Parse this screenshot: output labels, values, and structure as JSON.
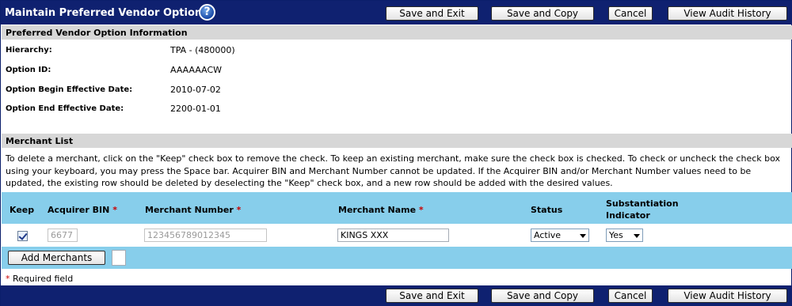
{
  "header": {
    "title": "Maintain Preferred Vendor Option",
    "help_icon": "?"
  },
  "actions": {
    "save_exit": "Save and Exit",
    "save_copy": "Save and Copy",
    "cancel": "Cancel",
    "audit": "View Audit History"
  },
  "info": {
    "section_title": "Preferred Vendor Option Information",
    "fields": [
      {
        "label": "Hierarchy:",
        "value": "TPA - (480000)"
      },
      {
        "label": "Option ID:",
        "value": "AAAAAACW"
      },
      {
        "label": "Option Begin Effective Date:",
        "value": "2010-07-02"
      },
      {
        "label": "Option End Effective Date:",
        "value": "2200-01-01"
      }
    ]
  },
  "merchant": {
    "section_title": "Merchant List",
    "instructions": "To delete a merchant, click on the \"Keep\" check box to remove the check. To keep an existing merchant, make sure the check box is checked. To check or uncheck the check box using your keyboard, you may press the Space bar. Acquirer BIN and Merchant Number cannot be updated. If the Acquirer BIN and/or Merchant Number values need to be updated, the existing row should be deleted by deselecting the \"Keep\" check box, and a new row should be added with the desired values.",
    "columns": {
      "keep": "Keep",
      "acquirer_bin": "Acquirer BIN",
      "merchant_number": "Merchant Number",
      "merchant_name": "Merchant Name",
      "status": "Status",
      "subst_line1": "Substantiation",
      "subst_line2": "Indicator",
      "required_mark": "*"
    },
    "rows": [
      {
        "keep": true,
        "acquirer_bin": "6677",
        "merchant_number": "123456789012345",
        "merchant_name": "KINGS XXX",
        "status": "Active",
        "substantiation": "Yes"
      }
    ],
    "add_button": "Add Merchants"
  },
  "footer": {
    "required_mark": "*",
    "required_text": " Required field"
  }
}
